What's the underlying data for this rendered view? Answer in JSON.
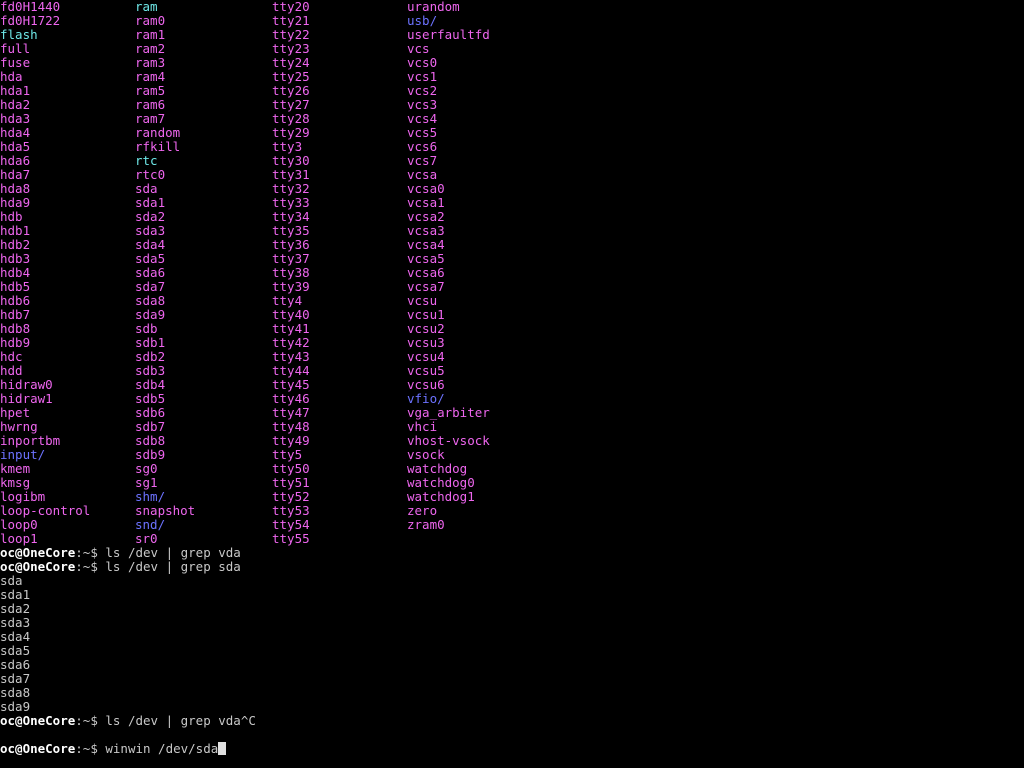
{
  "colors": {
    "dev": "#ee66ee",
    "dir": "#6c72ff",
    "link": "#6ee6e6",
    "text": "#c8c8c8",
    "prompt_user": "#ffffff"
  },
  "listing": {
    "columns": [
      [
        {
          "name": "fd0H1440",
          "kind": "dev"
        },
        {
          "name": "fd0H1722",
          "kind": "dev"
        },
        {
          "name": "flash",
          "kind": "link"
        },
        {
          "name": "full",
          "kind": "dev"
        },
        {
          "name": "fuse",
          "kind": "dev"
        },
        {
          "name": "hda",
          "kind": "dev"
        },
        {
          "name": "hda1",
          "kind": "dev"
        },
        {
          "name": "hda2",
          "kind": "dev"
        },
        {
          "name": "hda3",
          "kind": "dev"
        },
        {
          "name": "hda4",
          "kind": "dev"
        },
        {
          "name": "hda5",
          "kind": "dev"
        },
        {
          "name": "hda6",
          "kind": "dev"
        },
        {
          "name": "hda7",
          "kind": "dev"
        },
        {
          "name": "hda8",
          "kind": "dev"
        },
        {
          "name": "hda9",
          "kind": "dev"
        },
        {
          "name": "hdb",
          "kind": "dev"
        },
        {
          "name": "hdb1",
          "kind": "dev"
        },
        {
          "name": "hdb2",
          "kind": "dev"
        },
        {
          "name": "hdb3",
          "kind": "dev"
        },
        {
          "name": "hdb4",
          "kind": "dev"
        },
        {
          "name": "hdb5",
          "kind": "dev"
        },
        {
          "name": "hdb6",
          "kind": "dev"
        },
        {
          "name": "hdb7",
          "kind": "dev"
        },
        {
          "name": "hdb8",
          "kind": "dev"
        },
        {
          "name": "hdb9",
          "kind": "dev"
        },
        {
          "name": "hdc",
          "kind": "dev"
        },
        {
          "name": "hdd",
          "kind": "dev"
        },
        {
          "name": "hidraw0",
          "kind": "dev"
        },
        {
          "name": "hidraw1",
          "kind": "dev"
        },
        {
          "name": "hpet",
          "kind": "dev"
        },
        {
          "name": "hwrng",
          "kind": "dev"
        },
        {
          "name": "inportbm",
          "kind": "dev"
        },
        {
          "name": "input/",
          "kind": "dir"
        },
        {
          "name": "kmem",
          "kind": "dev"
        },
        {
          "name": "kmsg",
          "kind": "dev"
        },
        {
          "name": "logibm",
          "kind": "dev"
        },
        {
          "name": "loop-control",
          "kind": "dev"
        },
        {
          "name": "loop0",
          "kind": "dev"
        },
        {
          "name": "loop1",
          "kind": "dev"
        }
      ],
      [
        {
          "name": "ram",
          "kind": "link"
        },
        {
          "name": "ram0",
          "kind": "dev"
        },
        {
          "name": "ram1",
          "kind": "dev"
        },
        {
          "name": "ram2",
          "kind": "dev"
        },
        {
          "name": "ram3",
          "kind": "dev"
        },
        {
          "name": "ram4",
          "kind": "dev"
        },
        {
          "name": "ram5",
          "kind": "dev"
        },
        {
          "name": "ram6",
          "kind": "dev"
        },
        {
          "name": "ram7",
          "kind": "dev"
        },
        {
          "name": "random",
          "kind": "dev"
        },
        {
          "name": "rfkill",
          "kind": "dev"
        },
        {
          "name": "rtc",
          "kind": "link"
        },
        {
          "name": "rtc0",
          "kind": "dev"
        },
        {
          "name": "sda",
          "kind": "dev"
        },
        {
          "name": "sda1",
          "kind": "dev"
        },
        {
          "name": "sda2",
          "kind": "dev"
        },
        {
          "name": "sda3",
          "kind": "dev"
        },
        {
          "name": "sda4",
          "kind": "dev"
        },
        {
          "name": "sda5",
          "kind": "dev"
        },
        {
          "name": "sda6",
          "kind": "dev"
        },
        {
          "name": "sda7",
          "kind": "dev"
        },
        {
          "name": "sda8",
          "kind": "dev"
        },
        {
          "name": "sda9",
          "kind": "dev"
        },
        {
          "name": "sdb",
          "kind": "dev"
        },
        {
          "name": "sdb1",
          "kind": "dev"
        },
        {
          "name": "sdb2",
          "kind": "dev"
        },
        {
          "name": "sdb3",
          "kind": "dev"
        },
        {
          "name": "sdb4",
          "kind": "dev"
        },
        {
          "name": "sdb5",
          "kind": "dev"
        },
        {
          "name": "sdb6",
          "kind": "dev"
        },
        {
          "name": "sdb7",
          "kind": "dev"
        },
        {
          "name": "sdb8",
          "kind": "dev"
        },
        {
          "name": "sdb9",
          "kind": "dev"
        },
        {
          "name": "sg0",
          "kind": "dev"
        },
        {
          "name": "sg1",
          "kind": "dev"
        },
        {
          "name": "shm/",
          "kind": "dir"
        },
        {
          "name": "snapshot",
          "kind": "dev"
        },
        {
          "name": "snd/",
          "kind": "dir"
        },
        {
          "name": "sr0",
          "kind": "dev"
        }
      ],
      [
        {
          "name": "tty20",
          "kind": "dev"
        },
        {
          "name": "tty21",
          "kind": "dev"
        },
        {
          "name": "tty22",
          "kind": "dev"
        },
        {
          "name": "tty23",
          "kind": "dev"
        },
        {
          "name": "tty24",
          "kind": "dev"
        },
        {
          "name": "tty25",
          "kind": "dev"
        },
        {
          "name": "tty26",
          "kind": "dev"
        },
        {
          "name": "tty27",
          "kind": "dev"
        },
        {
          "name": "tty28",
          "kind": "dev"
        },
        {
          "name": "tty29",
          "kind": "dev"
        },
        {
          "name": "tty3",
          "kind": "dev"
        },
        {
          "name": "tty30",
          "kind": "dev"
        },
        {
          "name": "tty31",
          "kind": "dev"
        },
        {
          "name": "tty32",
          "kind": "dev"
        },
        {
          "name": "tty33",
          "kind": "dev"
        },
        {
          "name": "tty34",
          "kind": "dev"
        },
        {
          "name": "tty35",
          "kind": "dev"
        },
        {
          "name": "tty36",
          "kind": "dev"
        },
        {
          "name": "tty37",
          "kind": "dev"
        },
        {
          "name": "tty38",
          "kind": "dev"
        },
        {
          "name": "tty39",
          "kind": "dev"
        },
        {
          "name": "tty4",
          "kind": "dev"
        },
        {
          "name": "tty40",
          "kind": "dev"
        },
        {
          "name": "tty41",
          "kind": "dev"
        },
        {
          "name": "tty42",
          "kind": "dev"
        },
        {
          "name": "tty43",
          "kind": "dev"
        },
        {
          "name": "tty44",
          "kind": "dev"
        },
        {
          "name": "tty45",
          "kind": "dev"
        },
        {
          "name": "tty46",
          "kind": "dev"
        },
        {
          "name": "tty47",
          "kind": "dev"
        },
        {
          "name": "tty48",
          "kind": "dev"
        },
        {
          "name": "tty49",
          "kind": "dev"
        },
        {
          "name": "tty5",
          "kind": "dev"
        },
        {
          "name": "tty50",
          "kind": "dev"
        },
        {
          "name": "tty51",
          "kind": "dev"
        },
        {
          "name": "tty52",
          "kind": "dev"
        },
        {
          "name": "tty53",
          "kind": "dev"
        },
        {
          "name": "tty54",
          "kind": "dev"
        },
        {
          "name": "tty55",
          "kind": "dev"
        }
      ],
      [
        {
          "name": "urandom",
          "kind": "dev"
        },
        {
          "name": "usb/",
          "kind": "dir"
        },
        {
          "name": "userfaultfd",
          "kind": "dev"
        },
        {
          "name": "vcs",
          "kind": "dev"
        },
        {
          "name": "vcs0",
          "kind": "dev"
        },
        {
          "name": "vcs1",
          "kind": "dev"
        },
        {
          "name": "vcs2",
          "kind": "dev"
        },
        {
          "name": "vcs3",
          "kind": "dev"
        },
        {
          "name": "vcs4",
          "kind": "dev"
        },
        {
          "name": "vcs5",
          "kind": "dev"
        },
        {
          "name": "vcs6",
          "kind": "dev"
        },
        {
          "name": "vcs7",
          "kind": "dev"
        },
        {
          "name": "vcsa",
          "kind": "dev"
        },
        {
          "name": "vcsa0",
          "kind": "dev"
        },
        {
          "name": "vcsa1",
          "kind": "dev"
        },
        {
          "name": "vcsa2",
          "kind": "dev"
        },
        {
          "name": "vcsa3",
          "kind": "dev"
        },
        {
          "name": "vcsa4",
          "kind": "dev"
        },
        {
          "name": "vcsa5",
          "kind": "dev"
        },
        {
          "name": "vcsa6",
          "kind": "dev"
        },
        {
          "name": "vcsa7",
          "kind": "dev"
        },
        {
          "name": "vcsu",
          "kind": "dev"
        },
        {
          "name": "vcsu1",
          "kind": "dev"
        },
        {
          "name": "vcsu2",
          "kind": "dev"
        },
        {
          "name": "vcsu3",
          "kind": "dev"
        },
        {
          "name": "vcsu4",
          "kind": "dev"
        },
        {
          "name": "vcsu5",
          "kind": "dev"
        },
        {
          "name": "vcsu6",
          "kind": "dev"
        },
        {
          "name": "vfio/",
          "kind": "dir"
        },
        {
          "name": "vga_arbiter",
          "kind": "dev"
        },
        {
          "name": "vhci",
          "kind": "dev"
        },
        {
          "name": "vhost-vsock",
          "kind": "dev"
        },
        {
          "name": "vsock",
          "kind": "dev"
        },
        {
          "name": "watchdog",
          "kind": "dev"
        },
        {
          "name": "watchdog0",
          "kind": "dev"
        },
        {
          "name": "watchdog1",
          "kind": "dev"
        },
        {
          "name": "zero",
          "kind": "dev"
        },
        {
          "name": "zram0",
          "kind": "dev"
        }
      ]
    ]
  },
  "session": {
    "lines": [
      {
        "type": "prompt",
        "user": "oc@OneCore",
        "cwd": ":~$",
        "command": " ls /dev | grep vda"
      },
      {
        "type": "prompt",
        "user": "oc@OneCore",
        "cwd": ":~$",
        "command": " ls /dev | grep sda"
      },
      {
        "type": "output",
        "text": "sda"
      },
      {
        "type": "output",
        "text": "sda1"
      },
      {
        "type": "output",
        "text": "sda2"
      },
      {
        "type": "output",
        "text": "sda3"
      },
      {
        "type": "output",
        "text": "sda4"
      },
      {
        "type": "output",
        "text": "sda5"
      },
      {
        "type": "output",
        "text": "sda6"
      },
      {
        "type": "output",
        "text": "sda7"
      },
      {
        "type": "output",
        "text": "sda8"
      },
      {
        "type": "output",
        "text": "sda9"
      },
      {
        "type": "prompt",
        "user": "oc@OneCore",
        "cwd": ":~$",
        "command": " ls /dev | grep vda^C"
      },
      {
        "type": "output",
        "text": ""
      },
      {
        "type": "prompt",
        "user": "oc@OneCore",
        "cwd": ":~$",
        "command": " winwin /dev/sda",
        "cursor": true
      }
    ]
  }
}
